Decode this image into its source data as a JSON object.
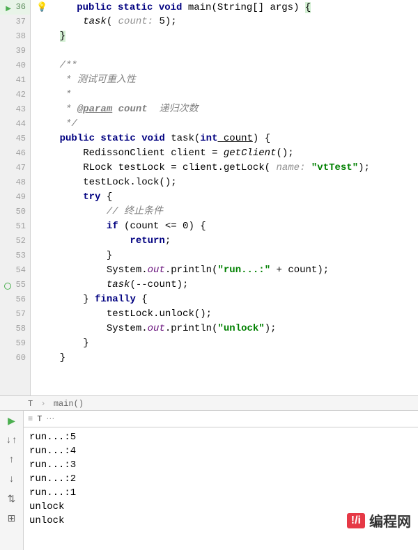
{
  "gutter": {
    "lines": [
      "36",
      "37",
      "38",
      "39",
      "40",
      "41",
      "42",
      "43",
      "44",
      "45",
      "46",
      "47",
      "48",
      "49",
      "50",
      "51",
      "52",
      "53",
      "54",
      "55",
      "56",
      "57",
      "58",
      "59",
      "60"
    ]
  },
  "code": {
    "l36": {
      "pre": "    ",
      "kw1": "public static void",
      "sp": " ",
      "name": "main",
      "paren": "(String[] args) "
    },
    "l37": {
      "pre": "        ",
      "call": "task",
      "open": "( ",
      "hint": "count: ",
      "val": "5);",
      "close": ""
    },
    "l38": {
      "pre": "    ",
      "brace": "}"
    },
    "l39": {
      "blank": " "
    },
    "l40": {
      "pre": "    ",
      "text": "/**"
    },
    "l41": {
      "pre": "     ",
      "text": "* 测试可重入性"
    },
    "l42": {
      "pre": "     ",
      "text": "*"
    },
    "l43": {
      "pre": "     ",
      "star": "* ",
      "tag": "@param",
      "sp": " ",
      "pname": "count",
      "rest": "  递归次数"
    },
    "l44": {
      "pre": "     ",
      "text": "*/"
    },
    "l45": {
      "pre": "    ",
      "kw1": "public static void",
      "sp": " ",
      "name": "task",
      "open": "(",
      "kw2": "int",
      "pname": " count",
      "rest": ") {"
    },
    "l46": {
      "pre": "        ",
      "text": "RedissonClient client = ",
      "ital": "getClient",
      "rest": "();"
    },
    "l47": {
      "pre": "        ",
      "text": "RLock testLock = client.getLock( ",
      "hint": "name: ",
      "str": "\"vtTest\"",
      "rest": ");"
    },
    "l48": {
      "pre": "        ",
      "text": "testLock.lock();"
    },
    "l49": {
      "pre": "        ",
      "kw": "try",
      "rest": " {"
    },
    "l50": {
      "pre": "            ",
      "text": "// 终止条件"
    },
    "l51": {
      "pre": "            ",
      "kw": "if",
      "rest": " (count <= 0) {"
    },
    "l52": {
      "pre": "                ",
      "kw": "return",
      "rest": ";"
    },
    "l53": {
      "pre": "            ",
      "text": "}"
    },
    "l54": {
      "pre": "            ",
      "text": "System.",
      "field": "out",
      "rest1": ".println(",
      "str": "\"run...:\"",
      "rest2": " + count);"
    },
    "l55": {
      "pre": "            ",
      "call": "task",
      "rest": "(--count);"
    },
    "l56": {
      "pre": "        ",
      "text": "} ",
      "kw": "finally",
      "rest": " {"
    },
    "l57": {
      "pre": "            ",
      "text": "testLock.unlock();"
    },
    "l58": {
      "pre": "            ",
      "text": "System.",
      "field": "out",
      "rest1": ".println(",
      "str": "\"unlock\"",
      "rest2": ");"
    },
    "l59": {
      "pre": "        ",
      "text": "}"
    },
    "l60": {
      "pre": "    ",
      "text": "}"
    }
  },
  "breadcrumb": {
    "cls": "T",
    "method": "main()"
  },
  "console": {
    "tab": "T",
    "output": [
      "run...:5",
      "run...:4",
      "run...:3",
      "run...:2",
      "run...:1",
      "unlock",
      "unlock"
    ]
  },
  "watermark": {
    "logo": "!/i",
    "text": "编程网"
  }
}
